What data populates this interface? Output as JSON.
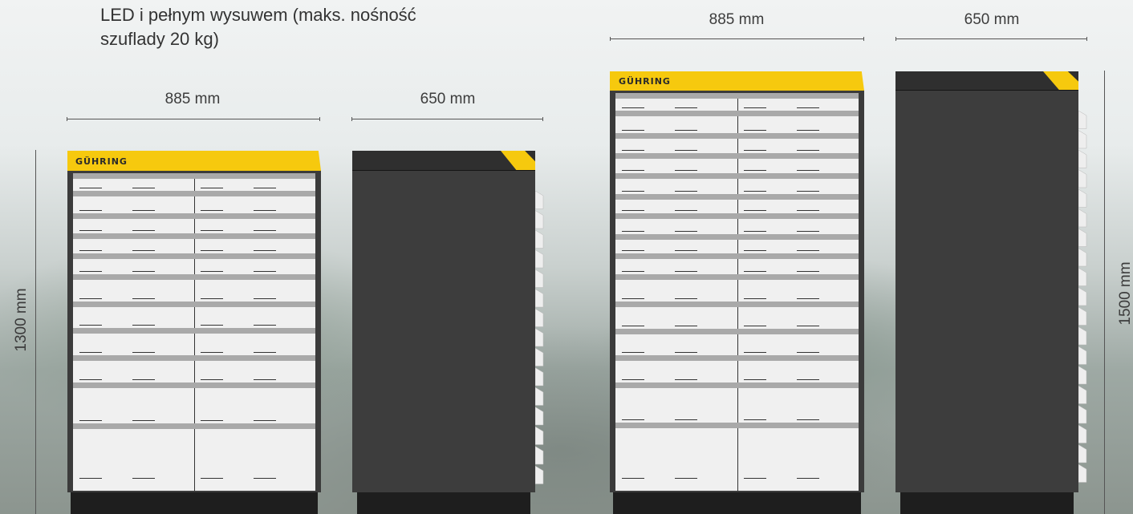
{
  "description": {
    "line1": "LED i pełnym wysuwem (maks. nośność",
    "line2": "szuflady 20 kg)"
  },
  "cabinet_small": {
    "width_label": "885 mm",
    "depth_label": "650 mm",
    "height_label": "1300 mm",
    "brand": "GÜHRING"
  },
  "cabinet_large": {
    "width_label": "885 mm",
    "depth_label": "650 mm",
    "height_label": "1500 mm",
    "brand": "GÜHRING"
  },
  "colors": {
    "accent": "#f6c90e",
    "cabinet_body": "#3b3b3b",
    "drawer_front": "#f0f0f0",
    "drawer_bar": "#a9a9a9"
  }
}
